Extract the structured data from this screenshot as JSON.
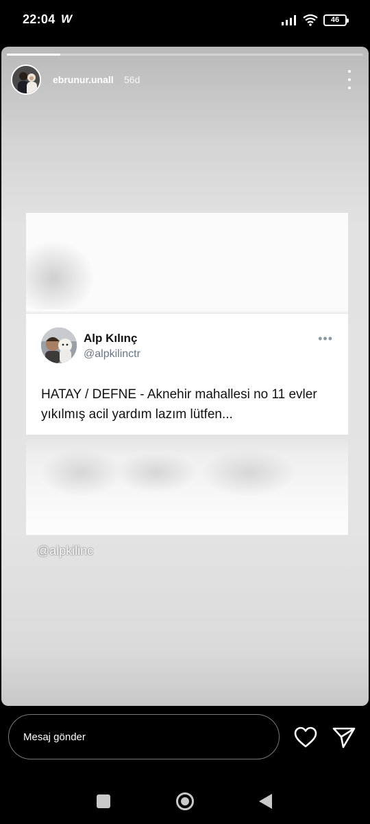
{
  "status_bar": {
    "time": "22:04",
    "carrier_icon": "W",
    "battery": "46",
    "icons": [
      "signal-icon",
      "wifi-icon",
      "battery-icon"
    ]
  },
  "story": {
    "progress": 0.15,
    "username": "ebrunur.unall",
    "time_ago": "56d",
    "mention": "@alpkilinc"
  },
  "tweet": {
    "name": "Alp Kılınç",
    "handle": "@alpkilinctr",
    "more": "•••",
    "text": "HATAY / DEFNE - Aknehir  mahallesi no 11 evler yıkılmış acil yardım lazım lütfen..."
  },
  "reply_bar": {
    "placeholder": "Mesaj gönder"
  },
  "colors": {
    "story_bg": "#e2e2e2",
    "handle": "#687684",
    "nav": "#c9c9c9"
  }
}
